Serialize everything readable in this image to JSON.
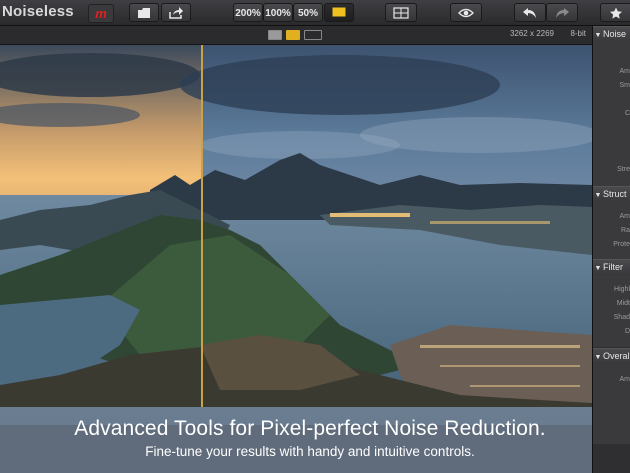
{
  "app": {
    "title": "Noiseless",
    "badge": "m"
  },
  "toolbar": {
    "zoom_200": "200%",
    "zoom_100": "100%",
    "zoom_50": "50%"
  },
  "image_info": {
    "dimensions": "3262 x 2269",
    "bit_depth": "8-bit"
  },
  "caption": {
    "headline": "Advanced Tools for Pixel-perfect Noise Reduction.",
    "subline": "Fine-tune your results with handy and intuitive controls."
  },
  "panel": {
    "sections": [
      {
        "title": "Noise",
        "labels": [
          "Am",
          "Sm",
          "C",
          "Stre"
        ]
      },
      {
        "title": "Struct",
        "labels": [
          "Am",
          "Ra",
          "Prote"
        ]
      },
      {
        "title": "Filter",
        "labels": [
          "Highl",
          "Midt",
          "Shad",
          "D"
        ]
      },
      {
        "title": "Overal",
        "labels": [
          "Am"
        ]
      }
    ]
  },
  "colors": {
    "divider": "#c9a24a",
    "badge": "#e02020",
    "accent": "#f0c020"
  }
}
